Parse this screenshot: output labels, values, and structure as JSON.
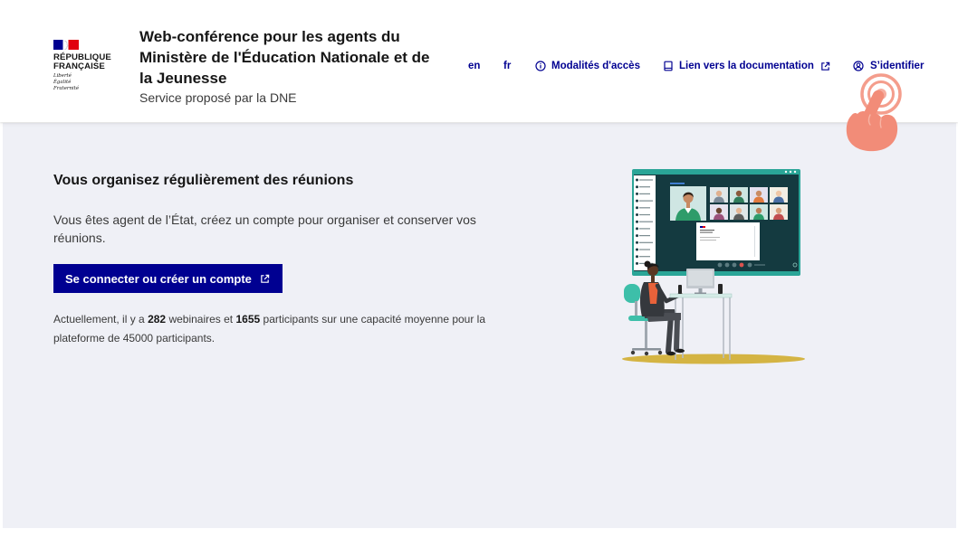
{
  "colors": {
    "brand_blue": "#000091",
    "brand_red": "#e1000f",
    "page_background": "#eff0f6",
    "cursor_hand": "#f28c78",
    "screen_frame": "#2aa597",
    "floor": "#d4b443"
  },
  "header": {
    "logo": {
      "line1": "RÉPUBLIQUE",
      "line2": "FRANÇAISE",
      "motto": [
        "Liberté",
        "Égalité",
        "Fraternité"
      ]
    },
    "service_title": "Web-conférence pour les agents du Ministère de l'Éducation Nationale et de la Jeunesse",
    "service_tagline": "Service proposé par la DNE",
    "nav": {
      "lang_en": "en",
      "lang_fr": "fr",
      "access": {
        "label": "Modalités d'accès",
        "icon": "info-icon"
      },
      "docs": {
        "label": "Lien vers la documentation",
        "icon": "book-icon",
        "trailing_icon": "external-link-icon"
      },
      "login": {
        "label": "S’identifier",
        "icon": "user-icon"
      }
    }
  },
  "cursor": {
    "icon": "pointer-hand-tap-icon"
  },
  "main": {
    "heading": "Vous organisez régulièrement des réunions",
    "text": "Vous êtes agent de l’État, créez un compte pour organiser et conserver vos réunions.",
    "cta": {
      "label": "Se connecter ou créer un compte",
      "icon": "external-link-icon"
    },
    "stats": {
      "prefix": "Actuellement, il y a",
      "webinars": "282",
      "webinars_label": "webinaires et",
      "participants": "1655",
      "suffix": "participants sur une capacité moyenne pour la plateforme de 45000 participants."
    }
  }
}
